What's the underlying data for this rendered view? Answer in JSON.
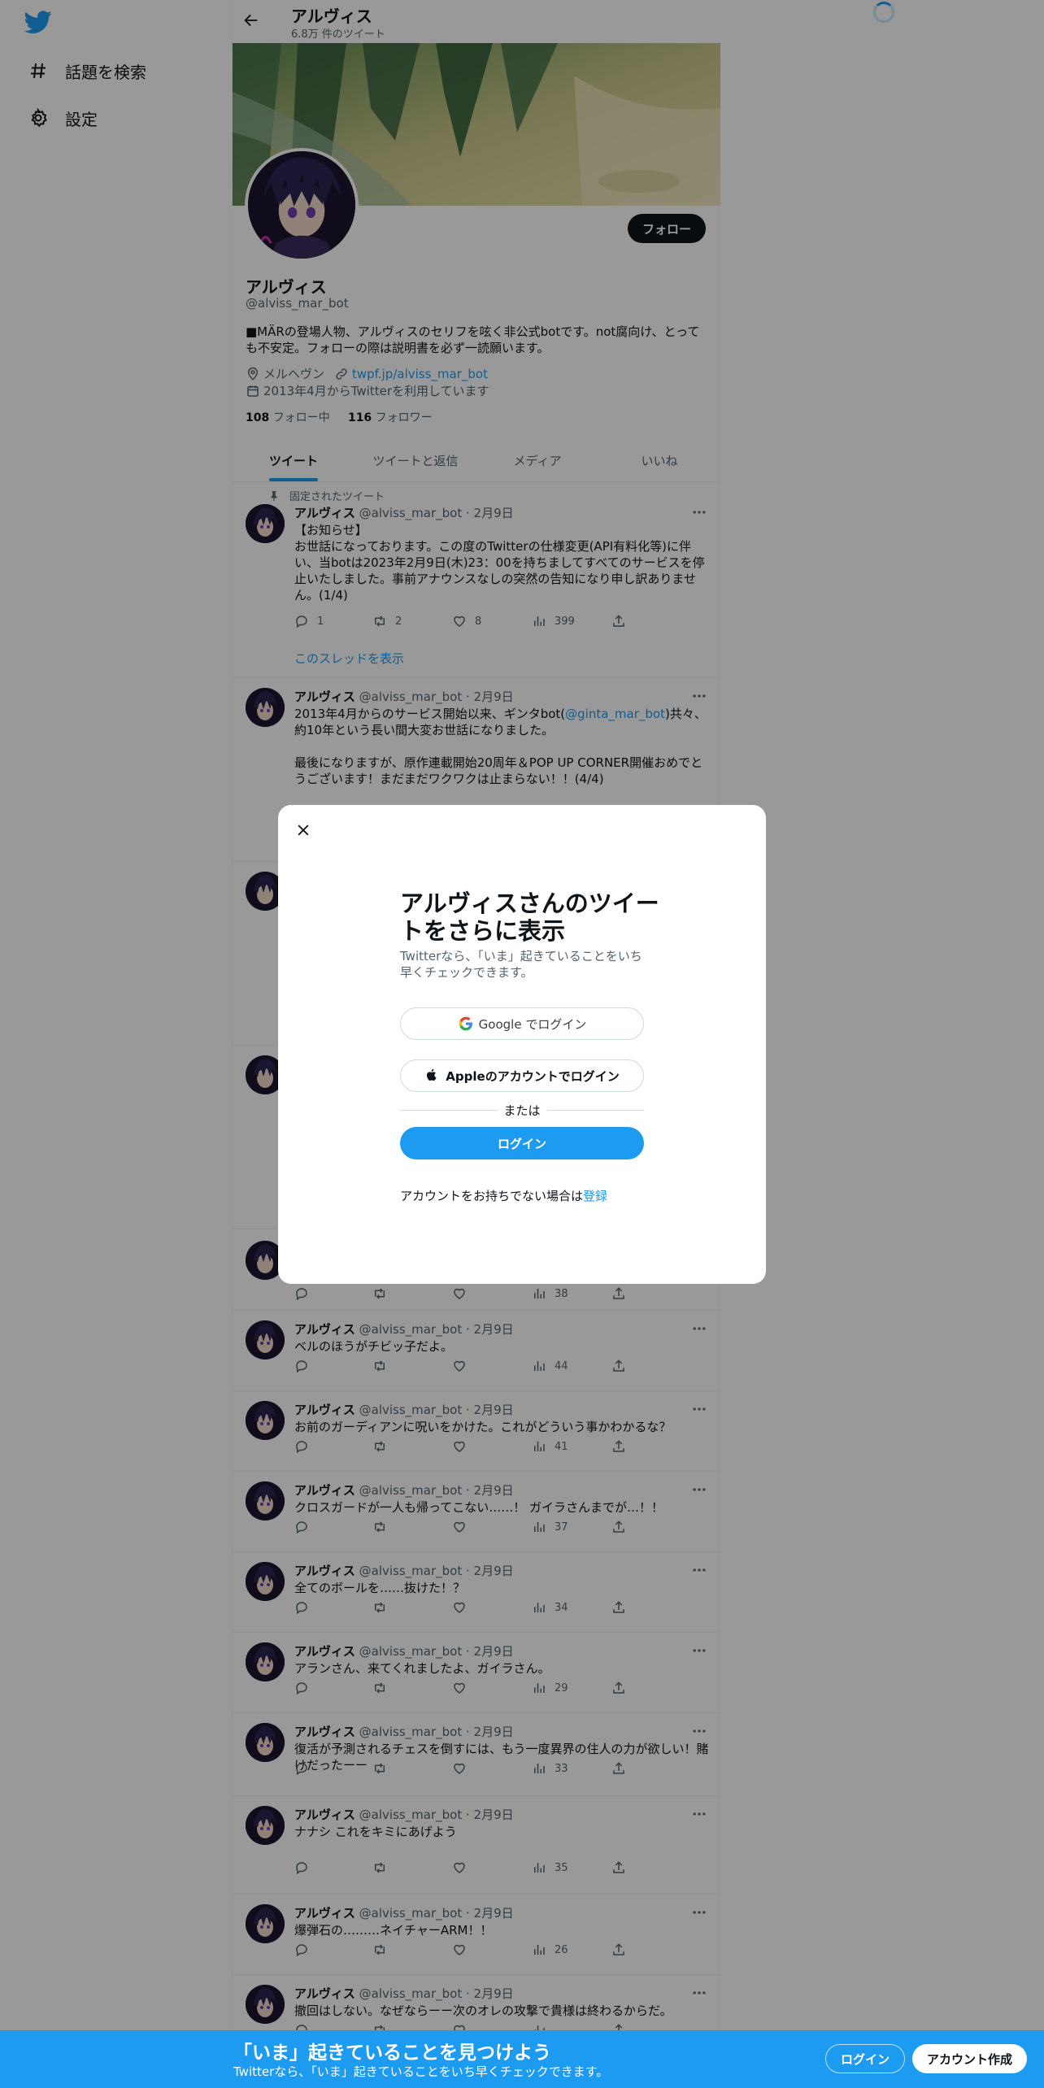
{
  "nav": {
    "explore": "話題を検索",
    "settings": "設定"
  },
  "header": {
    "name": "アルヴィス",
    "tweet_count": "6.8万 件のツイート"
  },
  "profile": {
    "follow": "フォロー",
    "name": "アルヴィス",
    "handle": "@alviss_mar_bot",
    "bio": "■MÄRの登場人物、アルヴィスのセリフを呟く非公式botです。not腐向け、とっても不安定。フォローの際は説明書を必ず一読願います。",
    "location": "メルヘヴン",
    "url": "twpf.jp/alviss_mar_bot",
    "joined": "2013年4月からTwitterを利用しています",
    "following_count": "108",
    "following_label": "フォロー中",
    "followers_count": "116",
    "followers_label": "フォロワー"
  },
  "tabs": [
    "ツイート",
    "ツイートと返信",
    "メディア",
    "いいね"
  ],
  "pinned_label": "固定されたツイート",
  "thread_link": "このスレッドを表示",
  "tweets": [
    {
      "name": "アルヴィス",
      "handle": "@alviss_mar_bot · 2月9日",
      "text": "【お知らせ】\nお世話になっております。この度のTwitterの仕様変更(API有料化等)に伴い、当botは2023年2月9日(木)23：00を持ちましてすべてのサービスを停止いたしました。事前アナウンスなしの突然の告知になり申し訳ありません。(1/4)",
      "replies": "1",
      "retweets": "2",
      "likes": "8",
      "views": "399"
    },
    {
      "name": "アルヴィス",
      "handle": "@alviss_mar_bot · 2月9日",
      "text_pre": "2013年4月からのサービス開始以来、ギンタbot(",
      "mention": "@ginta_mar_bot",
      "text_post": ")共々、約10年という長い間大変お世話になりました。\n\n最後になりますが、原作連載開始20周年＆POP UP CORNER開催おめでとうございます！まだまだワクワクは止まらない！！(4/4)"
    },
    {
      "views": "38"
    },
    {
      "name": "アルヴィス",
      "handle": "@alviss_mar_bot · 2月9日",
      "text": "ベルのほうがチビッ子だよ。",
      "views": "44"
    },
    {
      "name": "アルヴィス",
      "handle": "@alviss_mar_bot · 2月9日",
      "text": "お前のガーディアンに呪いをかけた。これがどういう事かわかるな？",
      "views": "41"
    },
    {
      "name": "アルヴィス",
      "handle": "@alviss_mar_bot · 2月9日",
      "text": "クロスガードが一人も帰ってこない……！ ガイラさんまでが…！！",
      "views": "37"
    },
    {
      "name": "アルヴィス",
      "handle": "@alviss_mar_bot · 2月9日",
      "text": "全てのボールを……抜けた！？",
      "views": "34"
    },
    {
      "name": "アルヴィス",
      "handle": "@alviss_mar_bot · 2月9日",
      "text": "アランさん、来てくれましたよ、ガイラさん。",
      "views": "29"
    },
    {
      "name": "アルヴィス",
      "handle": "@alviss_mar_bot · 2月9日",
      "text": "復活が予測されるチェスを倒すには、もう一度異界の住人の力が欲しい！賭けだったーー",
      "views": "33"
    },
    {
      "name": "アルヴィス",
      "handle": "@alviss_mar_bot · 2月9日",
      "text": "ナナシ これをキミにあげよう",
      "views": "35"
    },
    {
      "name": "アルヴィス",
      "handle": "@alviss_mar_bot · 2月9日",
      "text": "爆弾石の………ネイチャーARM！！",
      "views": "26"
    },
    {
      "name": "アルヴィス",
      "handle": "@alviss_mar_bot · 2月9日",
      "text": "撤回はしない。なぜならーー次のオレの攻撃で貴様は終わるからだ。"
    }
  ],
  "modal": {
    "title": "アルヴィスさんのツイートをさらに表示",
    "subtitle": "Twitterなら、「いま」起きていることをいち早くチェックできます。",
    "google": "Google でログイン",
    "apple": "Appleのアカウントでログイン",
    "or": "または",
    "login": "ログイン",
    "signup_prompt": "アカウントをお持ちでない場合は",
    "signup_link": "登録"
  },
  "bottom": {
    "headline": "「いま」起きていることを見つけよう",
    "subtext": "Twitterなら、「いま」起きていることをいち早くチェックできます。",
    "login": "ログイン",
    "signup": "アカウント作成"
  },
  "colors": {
    "accent": "#1d9bf0",
    "text": "#0f1419",
    "muted": "#536471"
  }
}
